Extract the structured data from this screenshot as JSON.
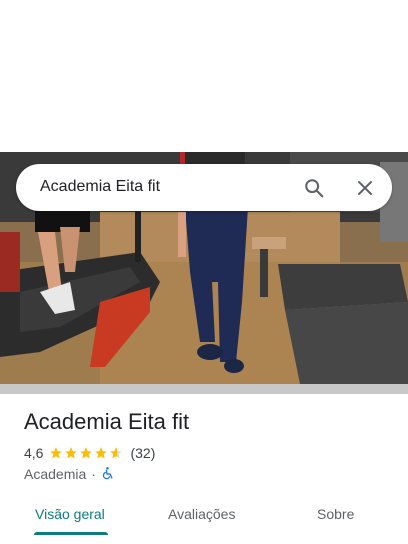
{
  "search": {
    "query": "Academia Eita fit",
    "search_icon": "search-icon",
    "close_icon": "close-icon"
  },
  "place": {
    "name": "Academia Eita fit",
    "rating": "4,6",
    "rating_value": 4.6,
    "review_count": "(32)",
    "category": "Academia",
    "separator": "·",
    "accessibility_icon": "wheelchair-icon"
  },
  "tabs": [
    {
      "label": "Visão geral",
      "active": true
    },
    {
      "label": "Avaliações",
      "active": false
    },
    {
      "label": "Sobre",
      "active": false
    }
  ],
  "colors": {
    "accent": "#0b7c81",
    "star": "#fbbc04",
    "accessibility": "#1a73e8"
  }
}
